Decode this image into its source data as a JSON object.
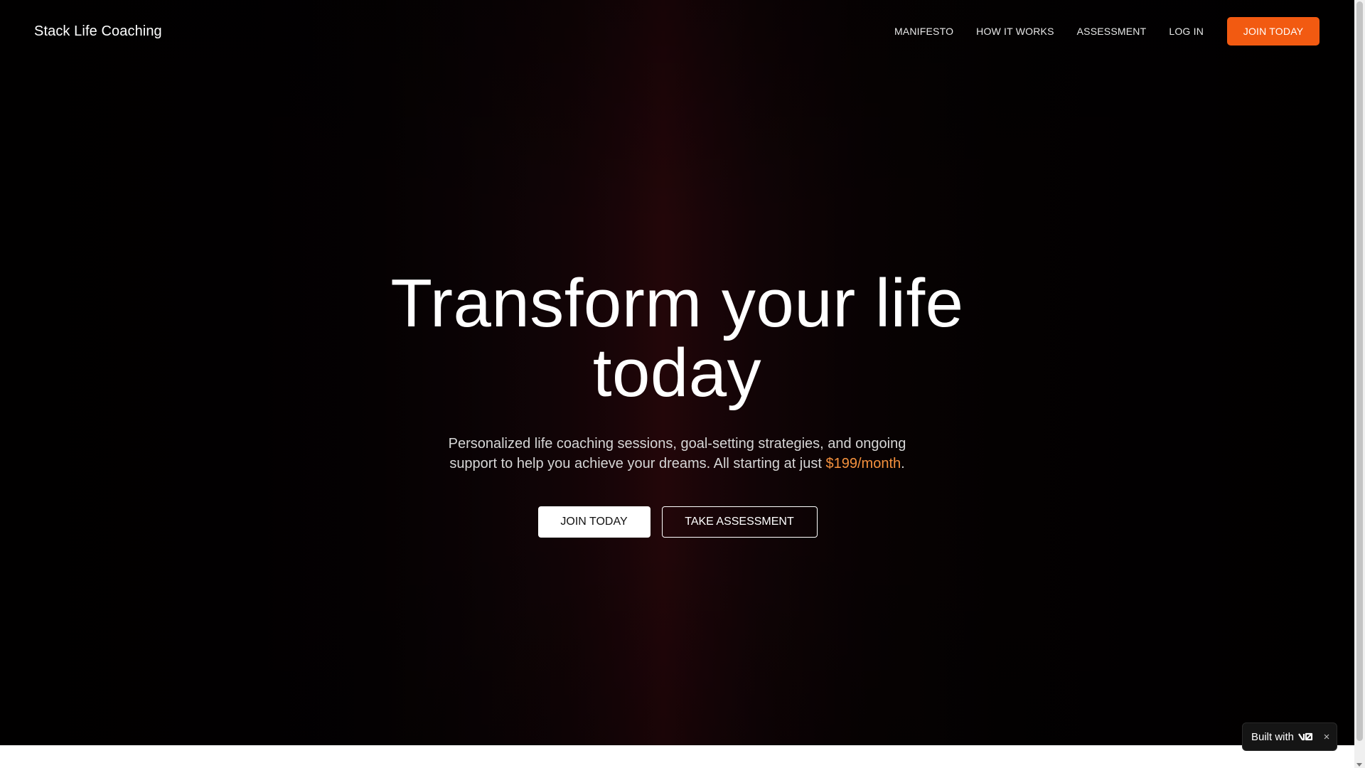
{
  "nav": {
    "brand": "Stack Life Coaching",
    "links": [
      "MANIFESTO",
      "HOW IT WORKS",
      "ASSESSMENT",
      "LOG IN"
    ],
    "cta": "JOIN TODAY"
  },
  "hero": {
    "headline": "Transform your life today",
    "subtext_before": "Personalized life coaching sessions, goal-setting strategies, and ongoing support to help you achieve your dreams. All starting at just ",
    "price": "$199/month",
    "subtext_after": ".",
    "primary_button": "JOIN TODAY",
    "secondary_button": "TAKE ASSESSMENT"
  },
  "badge": {
    "label": "Built with",
    "logo_icon": "v0-logo-icon",
    "close_icon": "close-icon"
  },
  "colors": {
    "accent": "#f25a11",
    "price": "#f5913e",
    "background": "#050102"
  }
}
